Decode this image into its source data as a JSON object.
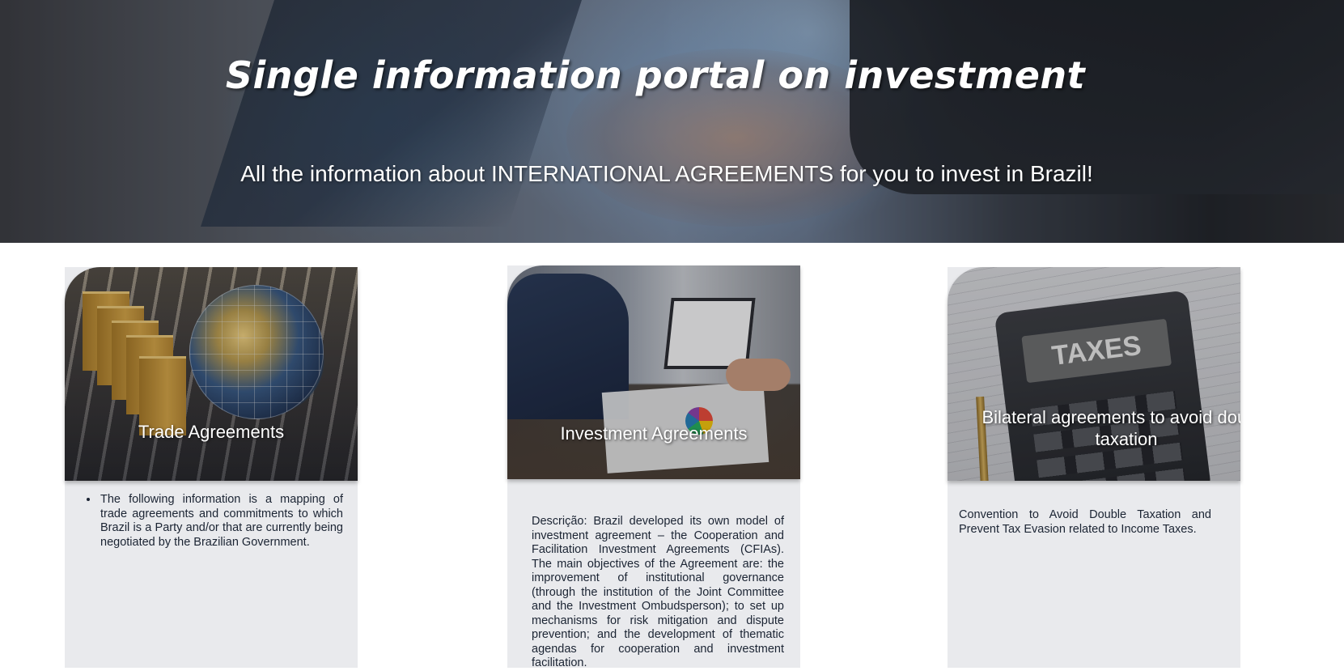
{
  "hero": {
    "title": "Single information portal on investment",
    "subtitle": "All the information about INTERNATIONAL AGREEMENTS for you to invest in Brazil!"
  },
  "cards": [
    {
      "title": "Trade Agreements",
      "image_icon": "shopping-bags-globe-keyboard-image",
      "description": "The following information is a mapping of trade agreements and commitments to which Brazil is a Party and/or that are currently being negotiated by the Brazilian Government."
    },
    {
      "title": "Investment Agreements",
      "image_icon": "business-meeting-charts-image",
      "description": "Descrição: Brazil developed its own model of investment agreement – the Cooperation and Facilitation Investment Agreements (CFIAs). The main objectives of the Agreement are: the improvement of institutional governance (through the institution of the Joint Committee and the Investment Ombudsperson); to set up mechanisms for risk mitigation and dispute prevention; and the development of thematic agendas for cooperation and investment facilitation."
    },
    {
      "title": "Bilateral agreements to avoid double taxation",
      "image_icon": "taxes-calculator-image",
      "image_text": "TAXES",
      "description": "Convention to Avoid Double Taxation and Prevent Tax Evasion related to Income Taxes."
    }
  ],
  "colors": {
    "card_background": "#e9eaed",
    "body_text": "#1b2433",
    "heading_text": "#ffffff"
  }
}
